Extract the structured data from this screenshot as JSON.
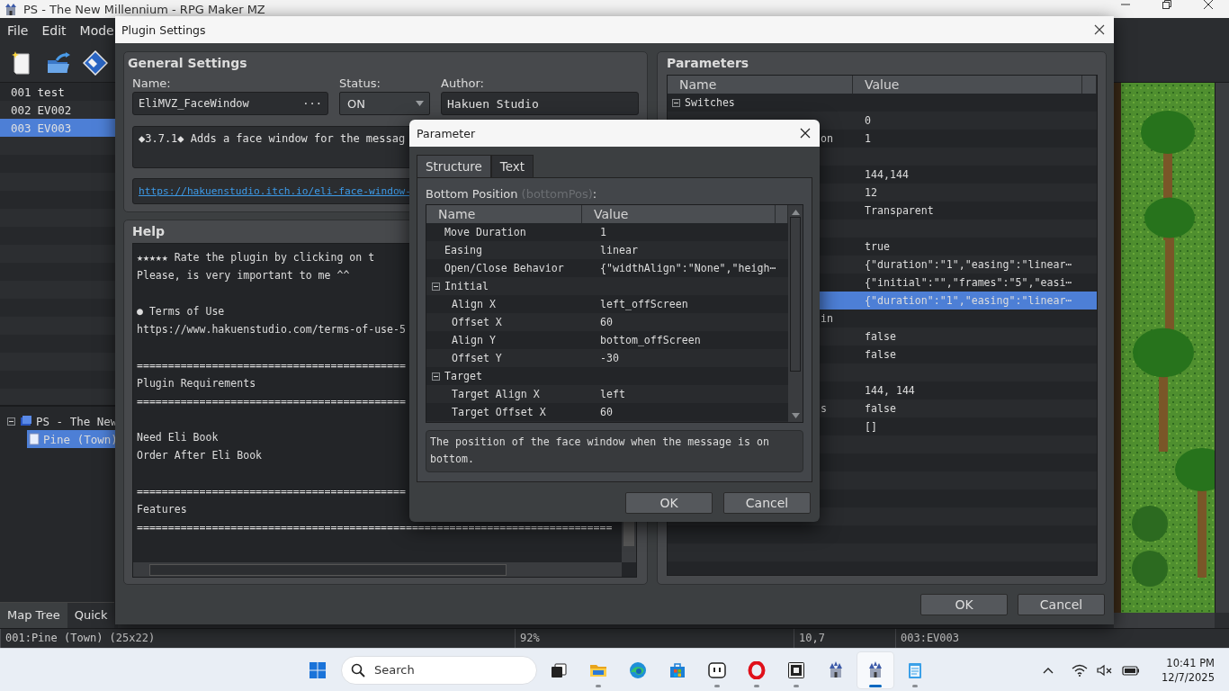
{
  "window": {
    "title": "PS - The New Millennium - RPG Maker MZ"
  },
  "menu": [
    "File",
    "Edit",
    "Mode"
  ],
  "events": [
    {
      "number": "001",
      "name": "test",
      "selected": false
    },
    {
      "number": "002",
      "name": "EV002",
      "selected": false
    },
    {
      "number": "003",
      "name": "EV003",
      "selected": true
    }
  ],
  "map_tree": [
    {
      "name": "PS - The New",
      "expanded": true,
      "selected": false,
      "children": [
        {
          "name": "Pine (Town)",
          "selected": true
        }
      ]
    }
  ],
  "left_tabs": [
    {
      "label": "Map Tree",
      "selected": true
    },
    {
      "label": "Quick",
      "selected": false
    }
  ],
  "status_bar": [
    "001:Pine (Town) (25x22)",
    "92%",
    "10,7",
    "003:EV003"
  ],
  "plugin_settings": {
    "title": "Plugin Settings",
    "general": {
      "heading": "General Settings",
      "name_label": "Name:",
      "name": "EliMVZ_FaceWindow",
      "name_button": "···",
      "status_label": "Status:",
      "status": "ON",
      "author_label": "Author:",
      "author": "Hakuen Studio",
      "description": "◆3.7.1◆ Adds a face window for the messag",
      "link": "https://hakuenstudio.itch.io/eli-face-window-"
    },
    "help": {
      "heading": "Help",
      "lines": [
        {
          "kind": "text",
          "text": "★★★★★ Rate the plugin by clicking on t"
        },
        {
          "kind": "text",
          "text": "Please, is very important to me ^^"
        },
        {
          "kind": "blank"
        },
        {
          "kind": "text",
          "text": "● Terms of Use"
        },
        {
          "kind": "text",
          "text": "https://www.hakuenstudio.com/terms-of-use-5"
        },
        {
          "kind": "blank"
        },
        {
          "kind": "text",
          "text": "==========================================="
        },
        {
          "kind": "text",
          "text": "Plugin Requirements"
        },
        {
          "kind": "text",
          "text": "==========================================="
        },
        {
          "kind": "blank"
        },
        {
          "kind": "text",
          "text": "Need Eli Book"
        },
        {
          "kind": "text",
          "text": "Order After Eli Book"
        },
        {
          "kind": "blank"
        },
        {
          "kind": "text",
          "text": "==========================================="
        },
        {
          "kind": "text",
          "text": "Features"
        },
        {
          "kind": "text",
          "text": "============================================================================"
        }
      ]
    },
    "parameters": {
      "heading": "Parameters",
      "columns": [
        "Name",
        "Value"
      ],
      "rows": [
        {
          "kind": "group",
          "name": "Switches",
          "expanded": true,
          "selected": false,
          "children": [
            {
              "kind": "item",
              "value": "0",
              "selected": false
            },
            {
              "kind": "item",
              "name": "on",
              "value": "1",
              "selected": false
            }
          ]
        },
        {
          "kind": "item",
          "selected": false
        },
        {
          "kind": "item",
          "value": "144,144",
          "selected": false
        },
        {
          "kind": "item",
          "value": "12",
          "selected": false
        },
        {
          "kind": "item",
          "value": "Transparent",
          "selected": false
        },
        {
          "kind": "item",
          "selected": false
        },
        {
          "kind": "item",
          "value": "true",
          "selected": false
        },
        {
          "kind": "item",
          "value": "{\"duration\":\"1\",\"easing\":\"linear⋯",
          "selected": false
        },
        {
          "kind": "item",
          "value": "{\"initial\":\"\",\"frames\":\"5\",\"easi⋯",
          "selected": false
        },
        {
          "kind": "item",
          "value": "{\"duration\":\"1\",\"easing\":\"linear⋯",
          "selected": true
        },
        {
          "kind": "item",
          "name": "in",
          "selected": false
        },
        {
          "kind": "item",
          "value": "false",
          "selected": false
        },
        {
          "kind": "item",
          "value": "false",
          "selected": false
        },
        {
          "kind": "item",
          "selected": false
        },
        {
          "kind": "item",
          "value": "144, 144",
          "selected": false
        },
        {
          "kind": "item",
          "name": "s",
          "value": "false",
          "selected": false
        },
        {
          "kind": "item",
          "value": "[]",
          "selected": false
        }
      ]
    },
    "buttons": [
      "OK",
      "Cancel"
    ]
  },
  "parameter_dialog": {
    "title": "Parameter",
    "tabs": [
      {
        "label": "Structure",
        "selected": true
      },
      {
        "label": "Text",
        "selected": false
      }
    ],
    "label": "Bottom Position",
    "key": "(bottomPos)",
    "colon": ":",
    "columns": [
      "Name",
      "Value"
    ],
    "rows": [
      {
        "kind": "item",
        "name": "Move Duration",
        "value": "1",
        "selected": false
      },
      {
        "kind": "item",
        "name": "Easing",
        "value": "linear",
        "selected": false
      },
      {
        "kind": "item",
        "name": "Open/Close Behavior",
        "value": "{\"widthAlign\":\"None\",\"heigh⋯",
        "selected": false
      },
      {
        "kind": "group",
        "name": "Initial",
        "expanded": true,
        "selected": false,
        "children": [
          {
            "kind": "item",
            "name": "Align X",
            "value": "left_offScreen",
            "selected": false
          },
          {
            "kind": "item",
            "name": "Offset X",
            "value": "60",
            "selected": false
          },
          {
            "kind": "item",
            "name": "Align Y",
            "value": "bottom_offScreen",
            "selected": false
          },
          {
            "kind": "item",
            "name": "Offset Y",
            "value": "-30",
            "selected": false
          }
        ]
      },
      {
        "kind": "group",
        "name": "Target",
        "expanded": true,
        "selected": false,
        "children": [
          {
            "kind": "item",
            "name": "Target Align X",
            "value": "left",
            "selected": false
          },
          {
            "kind": "item",
            "name": "Target Offset X",
            "value": "60",
            "selected": false
          }
        ]
      }
    ],
    "description": "The position of the face window when the message is on bottom.",
    "buttons": [
      "OK",
      "Cancel"
    ]
  },
  "taskbar": {
    "items": [
      {
        "kind": "start",
        "running": false,
        "active": false
      },
      {
        "kind": "search",
        "placeholder": "Search"
      },
      {
        "kind": "task_view",
        "running": false,
        "active": false
      },
      {
        "kind": "files",
        "running": true,
        "active": false
      },
      {
        "kind": "browser",
        "running": false,
        "active": false
      },
      {
        "kind": "store",
        "running": false,
        "active": false
      },
      {
        "kind": "robot",
        "running": true,
        "active": false
      },
      {
        "kind": "ring",
        "running": true,
        "active": false
      },
      {
        "kind": "game",
        "running": true,
        "active": false
      },
      {
        "kind": "castle",
        "running": false,
        "active": false
      },
      {
        "kind": "castle",
        "running": true,
        "active": true
      },
      {
        "kind": "notepad",
        "running": true,
        "active": false
      }
    ],
    "clock": {
      "time": "10:41 PM",
      "date": "12/7/2025"
    }
  }
}
